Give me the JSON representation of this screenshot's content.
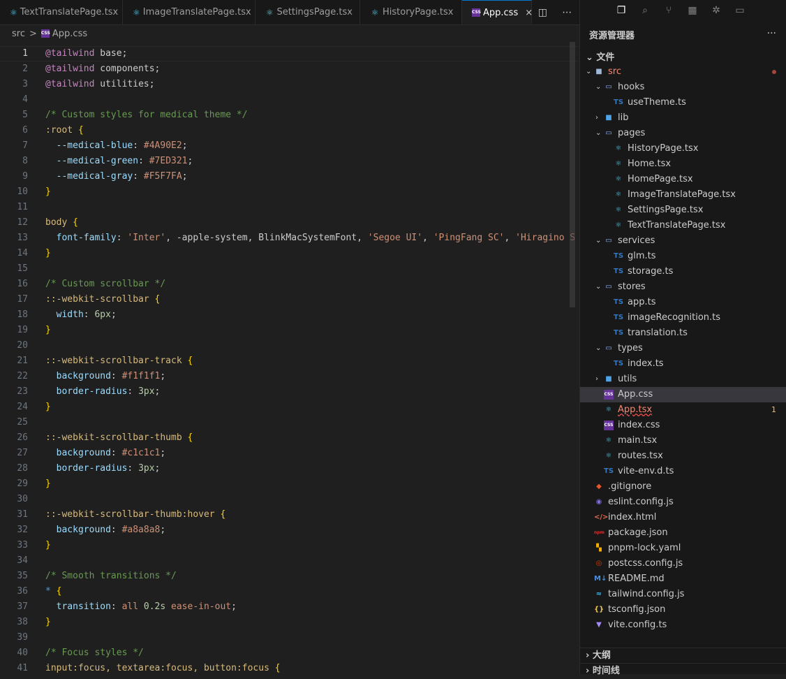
{
  "tabs": [
    {
      "label": "TextTranslatePage.tsx",
      "icon": "react-icon"
    },
    {
      "label": "ImageTranslatePage.tsx",
      "icon": "react-icon"
    },
    {
      "label": "SettingsPage.tsx",
      "icon": "react-icon"
    },
    {
      "label": "HistoryPage.tsx",
      "icon": "react-icon"
    },
    {
      "label": "App.css",
      "icon": "css-icon",
      "active": true
    }
  ],
  "tab_close": "×",
  "breadcrumb": {
    "folder": "src",
    "sep": ">",
    "file": "App.css"
  },
  "code_lines": [
    {
      "n": "1"
    },
    {
      "n": "2"
    },
    {
      "n": "3"
    },
    {
      "n": "4"
    },
    {
      "n": "5"
    },
    {
      "n": "6"
    },
    {
      "n": "7"
    },
    {
      "n": "8"
    },
    {
      "n": "9"
    },
    {
      "n": "10"
    },
    {
      "n": "11"
    },
    {
      "n": "12"
    },
    {
      "n": "13"
    },
    {
      "n": "14"
    },
    {
      "n": "15"
    },
    {
      "n": "16"
    },
    {
      "n": "17"
    },
    {
      "n": "18"
    },
    {
      "n": "19"
    },
    {
      "n": "20"
    },
    {
      "n": "21"
    },
    {
      "n": "22"
    },
    {
      "n": "23"
    },
    {
      "n": "24"
    },
    {
      "n": "25"
    },
    {
      "n": "26"
    },
    {
      "n": "27"
    },
    {
      "n": "28"
    },
    {
      "n": "29"
    },
    {
      "n": "30"
    },
    {
      "n": "31"
    },
    {
      "n": "32"
    },
    {
      "n": "33"
    },
    {
      "n": "34"
    },
    {
      "n": "35"
    },
    {
      "n": "36"
    },
    {
      "n": "37"
    },
    {
      "n": "38"
    },
    {
      "n": "39"
    },
    {
      "n": "40"
    },
    {
      "n": "41"
    }
  ],
  "code": {
    "l1": [
      "@tailwind",
      " base;"
    ],
    "l2": [
      "@tailwind",
      " components;"
    ],
    "l3": [
      "@tailwind",
      " utilities;"
    ],
    "l5": "/* Custom styles for medical theme */",
    "l6": [
      ":root",
      " {"
    ],
    "l7": [
      "  --medical-blue",
      ": ",
      "#4A90E2",
      ";"
    ],
    "l8": [
      "  --medical-green",
      ": ",
      "#7ED321",
      ";"
    ],
    "l9": [
      "  --medical-gray",
      ": ",
      "#F5F7FA",
      ";"
    ],
    "l10": "}",
    "l12": [
      "body",
      " {"
    ],
    "l13": [
      "  font-family",
      ": ",
      "'Inter'",
      ", -apple-system, BlinkMacSystemFont, ",
      "'Segoe UI'",
      ", ",
      "'PingFang SC'",
      ", ",
      "'Hiragino Sa"
    ],
    "l14": "}",
    "l16": "/* Custom scrollbar */",
    "l17": [
      "::-webkit-scrollbar",
      " {"
    ],
    "l18": [
      "  width",
      ": ",
      "6px",
      ";"
    ],
    "l19": "}",
    "l21": [
      "::-webkit-scrollbar-track",
      " {"
    ],
    "l22": [
      "  background",
      ": ",
      "#f1f1f1",
      ";"
    ],
    "l23": [
      "  border-radius",
      ": ",
      "3px",
      ";"
    ],
    "l24": "}",
    "l26": [
      "::-webkit-scrollbar-thumb",
      " {"
    ],
    "l27": [
      "  background",
      ": ",
      "#c1c1c1",
      ";"
    ],
    "l28": [
      "  border-radius",
      ": ",
      "3px",
      ";"
    ],
    "l29": "}",
    "l31": [
      "::-webkit-scrollbar-thumb:hover",
      " {"
    ],
    "l32": [
      "  background",
      ": ",
      "#a8a8a8",
      ";"
    ],
    "l33": "}",
    "l35": "/* Smooth transitions */",
    "l36": [
      "*",
      " {"
    ],
    "l37": [
      "  transition",
      ": ",
      "all",
      " ",
      "0.2s",
      " ",
      "ease-in-out",
      ";"
    ],
    "l38": "}",
    "l40": "/* Focus styles */",
    "l41": [
      "input:focus, textarea:focus, button:focus",
      " {"
    ]
  },
  "sidebar": {
    "title": "资源管理器",
    "more": "···",
    "section": "文件",
    "outline": "大纲",
    "timeline": "时间线",
    "tree": [
      {
        "name": "src",
        "type": "folder-src",
        "badge": "dot"
      },
      {
        "name": "hooks",
        "type": "folder"
      },
      {
        "name": "useTheme.ts",
        "type": "ts"
      },
      {
        "name": "lib",
        "type": "folder-closed"
      },
      {
        "name": "pages",
        "type": "folder"
      },
      {
        "name": "HistoryPage.tsx",
        "type": "react"
      },
      {
        "name": "Home.tsx",
        "type": "react"
      },
      {
        "name": "HomePage.tsx",
        "type": "react"
      },
      {
        "name": "ImageTranslatePage.tsx",
        "type": "react"
      },
      {
        "name": "SettingsPage.tsx",
        "type": "react"
      },
      {
        "name": "TextTranslatePage.tsx",
        "type": "react"
      },
      {
        "name": "services",
        "type": "folder"
      },
      {
        "name": "glm.ts",
        "type": "ts"
      },
      {
        "name": "storage.ts",
        "type": "ts"
      },
      {
        "name": "stores",
        "type": "folder"
      },
      {
        "name": "app.ts",
        "type": "ts"
      },
      {
        "name": "imageRecognition.ts",
        "type": "ts"
      },
      {
        "name": "translation.ts",
        "type": "ts"
      },
      {
        "name": "types",
        "type": "folder"
      },
      {
        "name": "index.ts",
        "type": "ts"
      },
      {
        "name": "utils",
        "type": "folder-closed"
      },
      {
        "name": "App.css",
        "type": "css",
        "selected": true
      },
      {
        "name": "App.tsx",
        "type": "react",
        "badge": "1",
        "error": true
      },
      {
        "name": "index.css",
        "type": "css"
      },
      {
        "name": "main.tsx",
        "type": "react"
      },
      {
        "name": "routes.tsx",
        "type": "react"
      },
      {
        "name": "vite-env.d.ts",
        "type": "ts"
      },
      {
        "name": ".gitignore",
        "type": "git"
      },
      {
        "name": "eslint.config.js",
        "type": "eslint"
      },
      {
        "name": "index.html",
        "type": "html"
      },
      {
        "name": "package.json",
        "type": "npm"
      },
      {
        "name": "pnpm-lock.yaml",
        "type": "pnpm"
      },
      {
        "name": "postcss.config.js",
        "type": "postcss"
      },
      {
        "name": "README.md",
        "type": "md"
      },
      {
        "name": "tailwind.config.js",
        "type": "tailwind"
      },
      {
        "name": "tsconfig.json",
        "type": "json"
      },
      {
        "name": "vite.config.ts",
        "type": "vite"
      }
    ]
  },
  "colors": {
    "accent": "#0078d4",
    "selection": "#37373d",
    "error": "#f48771",
    "ts": "#3178c6",
    "react": "#58c4dc"
  }
}
